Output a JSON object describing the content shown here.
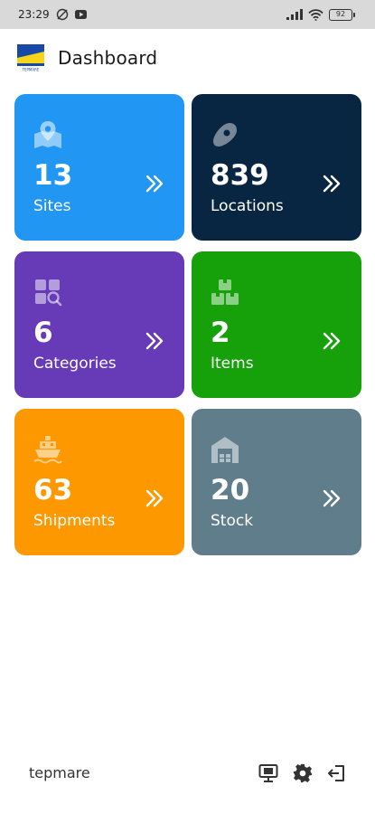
{
  "status_bar": {
    "time": "23:29",
    "battery": "92",
    "icons": [
      "do-not-disturb-icon",
      "youtube-icon",
      "signal-icon",
      "wifi-icon",
      "battery-icon"
    ]
  },
  "header": {
    "title": "Dashboard",
    "logo_icon": "tepmare-logo",
    "logo_text": "TEPMARE"
  },
  "cards": [
    {
      "count": "13",
      "label": "Sites",
      "color": "#2196f3",
      "icon": "map-pin-icon"
    },
    {
      "count": "839",
      "label": "Locations",
      "color": "#082542",
      "icon": "location-marker-icon"
    },
    {
      "count": "6",
      "label": "Categories",
      "color": "#673ab7",
      "icon": "category-search-icon"
    },
    {
      "count": "2",
      "label": "Items",
      "color": "#16a00a",
      "icon": "boxes-icon"
    },
    {
      "count": "63",
      "label": "Shipments",
      "color": "#fe9800",
      "icon": "ship-icon"
    },
    {
      "count": "20",
      "label": "Stock",
      "color": "#607d8b",
      "icon": "warehouse-icon"
    }
  ],
  "footer": {
    "brand": "tepmare",
    "actions": [
      "monitor-icon",
      "settings-icon",
      "logout-icon"
    ]
  }
}
